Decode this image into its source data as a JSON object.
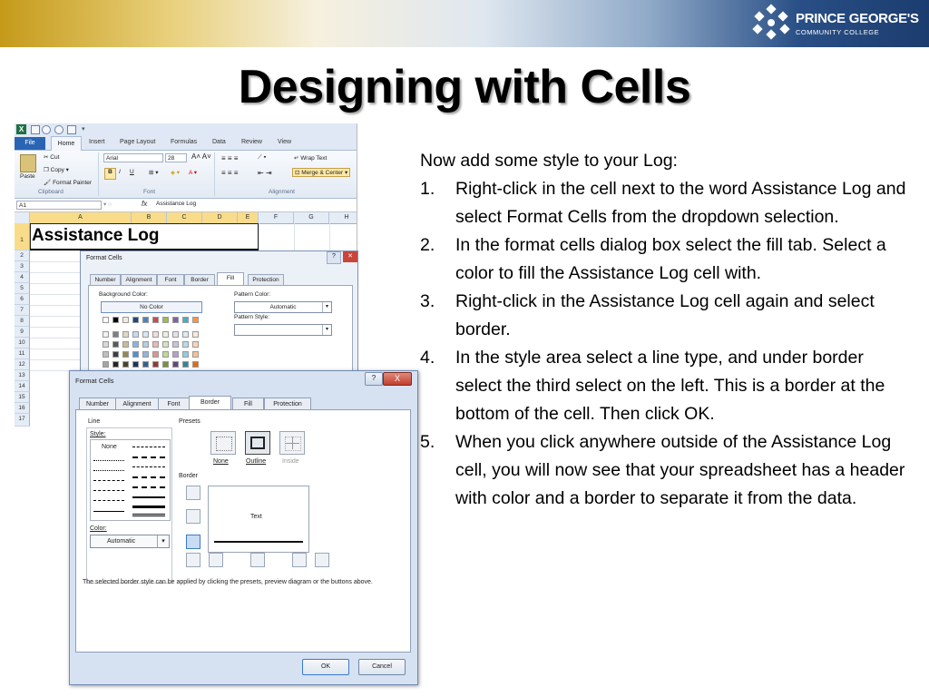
{
  "header": {
    "logo_line1": "PRINCE GEORGE'S",
    "logo_line2": "COMMUNITY COLLEGE",
    "logo_icon": "pgcc-logo-mark"
  },
  "title": "Designing with Cells",
  "excel": {
    "tabs": [
      "File",
      "Home",
      "Insert",
      "Page Layout",
      "Formulas",
      "Data",
      "Review",
      "View"
    ],
    "clipboard": {
      "paste": "Paste",
      "cut": "Cut",
      "copy": "Copy",
      "format_painter": "Format Painter",
      "group": "Clipboard"
    },
    "font": {
      "name": "Arial",
      "size": "28",
      "bold": "B",
      "italic": "I",
      "underline": "U",
      "group": "Font"
    },
    "alignment": {
      "wrap": "Wrap Text",
      "merge": "Merge & Center",
      "group": "Alignment"
    },
    "name_box": "A1",
    "fx": "fx",
    "formula": "Assistance Log",
    "columns": [
      "A",
      "B",
      "C",
      "D",
      "E",
      "F",
      "G",
      "H"
    ],
    "rows": [
      "1",
      "2",
      "3",
      "4",
      "5",
      "6",
      "7",
      "8",
      "9",
      "10",
      "11",
      "12",
      "13",
      "14",
      "15",
      "16",
      "17"
    ],
    "cell_a1": "Assistance Log"
  },
  "back_dialog": {
    "title": "Format Cells",
    "tabs": [
      "Number",
      "Alignment",
      "Font",
      "Border",
      "Fill",
      "Protection"
    ],
    "selected_tab": "Fill",
    "background_color_label": "Background Color:",
    "no_color": "No Color",
    "pattern_color_label": "Pattern Color:",
    "pattern_color_value": "Automatic",
    "pattern_style_label": "Pattern Style:"
  },
  "dialog": {
    "title": "Format Cells",
    "help": "?",
    "close": "X",
    "tabs": [
      "Number",
      "Alignment",
      "Font",
      "Border",
      "Fill",
      "Protection"
    ],
    "selected_tab": "Border",
    "line_label": "Line",
    "style_label": "Style:",
    "style_none": "None",
    "color_label": "Color:",
    "color_value": "Automatic",
    "presets_label": "Presets",
    "presets": [
      "None",
      "Outline",
      "Inside"
    ],
    "border_label": "Border",
    "preview_text": "Text",
    "hint": "The selected border style can be applied by clicking the presets, preview diagram or the buttons above.",
    "ok": "OK",
    "cancel": "Cancel"
  },
  "instructions": {
    "intro": "Now add some style to your Log:",
    "steps": [
      "Right-click in the cell next to the word Assistance Log and select Format Cells from the dropdown selection.",
      "In the format cells dialog box select the fill tab. Select a color to fill the Assistance Log cell with.",
      "Right-click in the Assistance Log cell again and select border.",
      "In the style area select a line type, and under border select the third select on the left. This is a border at the bottom of the cell. Then click OK.",
      "When you click anywhere outside of the Assistance Log cell, you will now see that your spreadsheet has a header with color and a border to separate it from the data."
    ]
  }
}
